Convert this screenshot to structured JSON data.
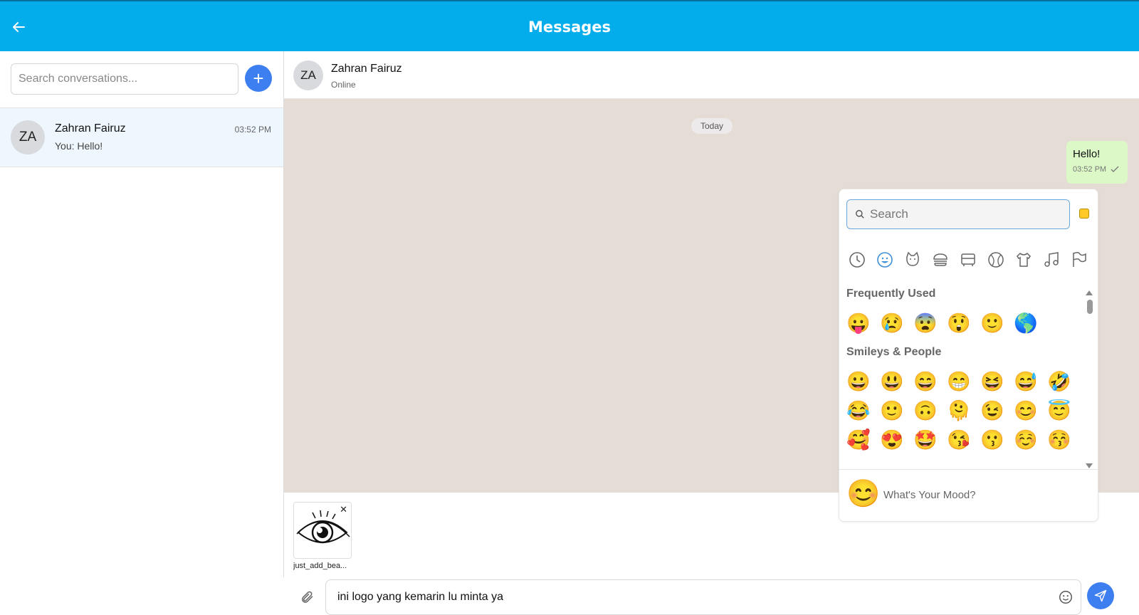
{
  "header": {
    "title": "Messages"
  },
  "sidebar": {
    "search_placeholder": "Search conversations...",
    "new_button": "+",
    "conversations": [
      {
        "initials": "ZA",
        "name": "Zahran Fairuz",
        "preview": "You: Hello!",
        "time": "03:52 PM"
      }
    ]
  },
  "chat": {
    "contact": {
      "initials": "ZA",
      "name": "Zahran Fairuz",
      "status": "Online"
    },
    "date_divider": "Today",
    "messages": [
      {
        "direction": "outgoing",
        "text": "Hello!",
        "time": "03:52 PM",
        "status_icon": "check-icon"
      }
    ],
    "attachment": {
      "name": "just_add_bea..."
    },
    "input_value": "ini logo yang kemarin lu minta ya"
  },
  "emoji_picker": {
    "search_placeholder": "Search",
    "categories": [
      "recent-icon",
      "smileys-icon",
      "animals-icon",
      "food-icon",
      "travel-icon",
      "activities-icon",
      "objects-icon",
      "symbols-icon",
      "flags-icon"
    ],
    "frequently_used_title": "Frequently Used",
    "frequently_used": [
      "😛",
      "😢",
      "😨",
      "😲",
      "🙂",
      "🌎"
    ],
    "smileys_title": "Smileys & People",
    "smileys_rows": [
      [
        "😀",
        "😃",
        "😄",
        "😁",
        "😆",
        "😅",
        "🤣"
      ],
      [
        "😂",
        "🙂",
        "🙃",
        "🫠",
        "😉",
        "😊",
        "😇"
      ],
      [
        "🥰",
        "😍",
        "🤩",
        "😘",
        "😗",
        "☺️",
        "😚"
      ]
    ],
    "footer_emoji": "😊",
    "footer_text": "What's Your Mood?"
  },
  "colors": {
    "topbar": "#03adec",
    "accent": "#3d7ef0",
    "chat_bg": "#e5ddd5",
    "outgoing_bubble": "#dcf8c6",
    "selected_conv": "#eef6fe"
  }
}
